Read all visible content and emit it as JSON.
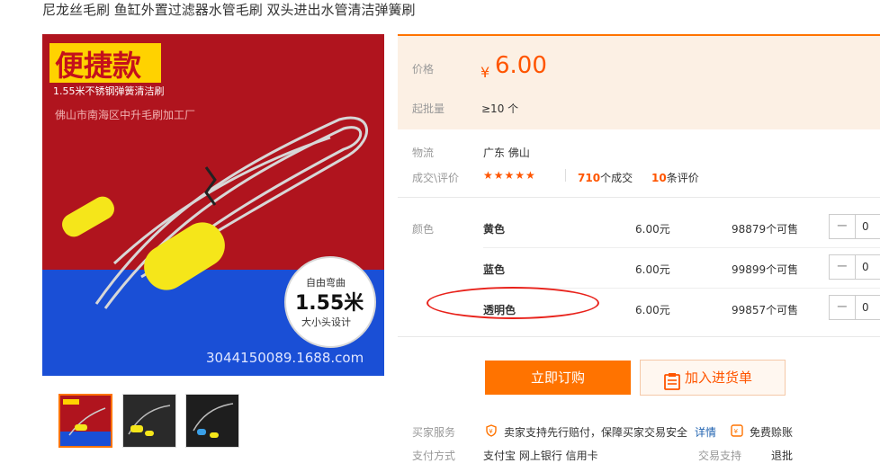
{
  "product": {
    "title": "尼龙丝毛刷 鱼缸外置过滤器水管毛刷 双头进出水管清洁弹簧刷"
  },
  "image": {
    "headline": "便捷款",
    "subline": "1.55米不锈钢弹簧清洁刷",
    "factory_watermark": "佛山市南海区中升毛刷加工厂",
    "badge_top": "自由弯曲",
    "badge_size": "1.55米",
    "badge_bottom": "大小头设计",
    "url_watermark": "3044150089.1688.com",
    "red_bg": "#b0141e",
    "blue_bg": "#1a4fd6",
    "brush_color": "#f5e61a"
  },
  "pricing": {
    "price_label": "价格",
    "currency": "¥",
    "price": "6.00",
    "moq_label": "起批量",
    "moq": "≥10 个"
  },
  "logistics": {
    "label": "物流",
    "location": "广东 佛山"
  },
  "reviews": {
    "label": "成交\\评价",
    "stars": "★★★★★",
    "deals_count": "710",
    "deals_suffix": "个成交",
    "reviews_count": "10",
    "reviews_suffix": "条评价"
  },
  "variants": {
    "label": "颜色",
    "rows": [
      {
        "name": "黄色",
        "price": "6.00元",
        "stock": "98879个可售",
        "qty": "0"
      },
      {
        "name": "蓝色",
        "price": "6.00元",
        "stock": "99899个可售",
        "qty": "0"
      },
      {
        "name": "透明色",
        "price": "6.00元",
        "stock": "99857个可售",
        "qty": "0"
      }
    ],
    "minus_glyph": "−"
  },
  "actions": {
    "order_label": "立即订购",
    "cart_label": "加入进货单"
  },
  "services": {
    "buyer_label": "买家服务",
    "buyer_text": "卖家支持先行赔付，保障买家交易安全",
    "details_link": "详情",
    "free_text": "免费赊账",
    "payment_label": "支付方式",
    "payment_methods": "支付宝  网上银行  信用卡",
    "trade_label": "交易支持",
    "trade_value": "退批"
  },
  "colors": {
    "accent": "#ff7300",
    "price": "#ff5500",
    "price_bg": "#fcf0e4",
    "annotation": "#e8221b",
    "link": "#1f62b0"
  }
}
